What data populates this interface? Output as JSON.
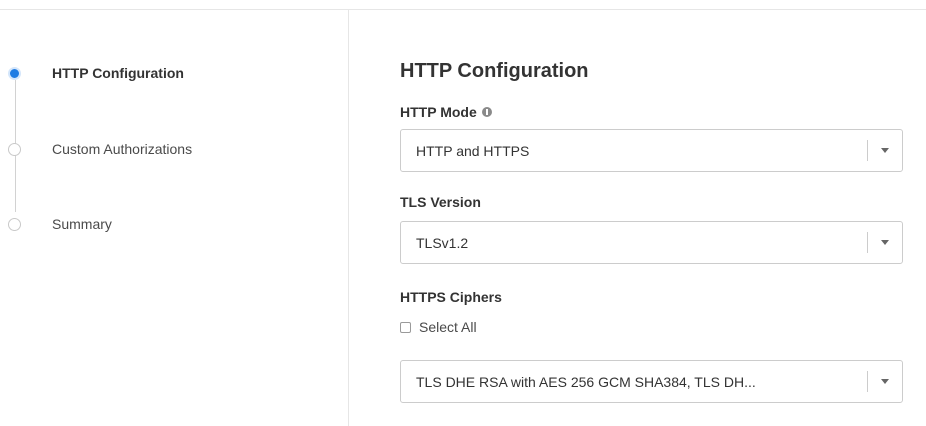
{
  "steps": [
    {
      "label": "HTTP Configuration",
      "active": true
    },
    {
      "label": "Custom Authorizations",
      "active": false
    },
    {
      "label": "Summary",
      "active": false
    }
  ],
  "form": {
    "title": "HTTP Configuration",
    "http_mode": {
      "label": "HTTP Mode",
      "info_icon": "info-icon",
      "value": "HTTP and HTTPS"
    },
    "tls_version": {
      "label": "TLS Version",
      "value": "TLSv1.2"
    },
    "https_ciphers": {
      "label": "HTTPS Ciphers",
      "select_all_label": "Select All",
      "select_all_checked": false,
      "value": "TLS DHE RSA with AES 256 GCM SHA384, TLS DH..."
    }
  },
  "colors": {
    "accent": "#1f7ce3",
    "border": "#cccccc",
    "text": "#333333"
  }
}
